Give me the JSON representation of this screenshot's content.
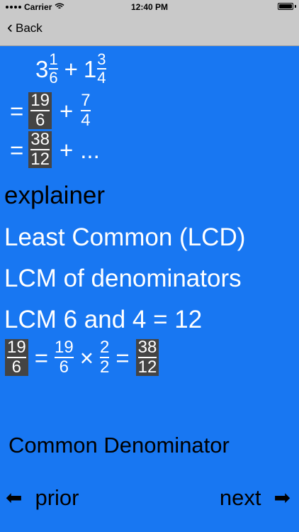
{
  "status": {
    "carrier": "Carrier",
    "time": "12:40 PM"
  },
  "nav": {
    "back_label": "Back"
  },
  "math": {
    "line1": {
      "whole1": "3",
      "frac1_num": "1",
      "frac1_den": "6",
      "plus": "+",
      "whole2": "1",
      "frac2_num": "3",
      "frac2_den": "4"
    },
    "line2": {
      "eq": "=",
      "frac1_num": "19",
      "frac1_den": "6",
      "plus": "+",
      "frac2_num": "7",
      "frac2_den": "4"
    },
    "line3": {
      "eq": "=",
      "frac1_num": "38",
      "frac1_den": "12",
      "plus": "+",
      "ellipsis": "..."
    },
    "line8": {
      "frac1_num": "19",
      "frac1_den": "6",
      "eq1": "=",
      "frac2_num": "19",
      "frac2_den": "6",
      "times": "×",
      "frac3_num": "2",
      "frac3_den": "2",
      "eq2": "=",
      "frac4_num": "38",
      "frac4_den": "12"
    }
  },
  "lines": {
    "explainer": "explainer",
    "lcd": "Least Common (LCD)",
    "lcm_denoms": "LCM of denominators",
    "lcm_values": "LCM 6 and 4 = 12",
    "common_denominator": "Common Denominator"
  },
  "footer": {
    "prior_label": "prior",
    "next_label": "next"
  }
}
